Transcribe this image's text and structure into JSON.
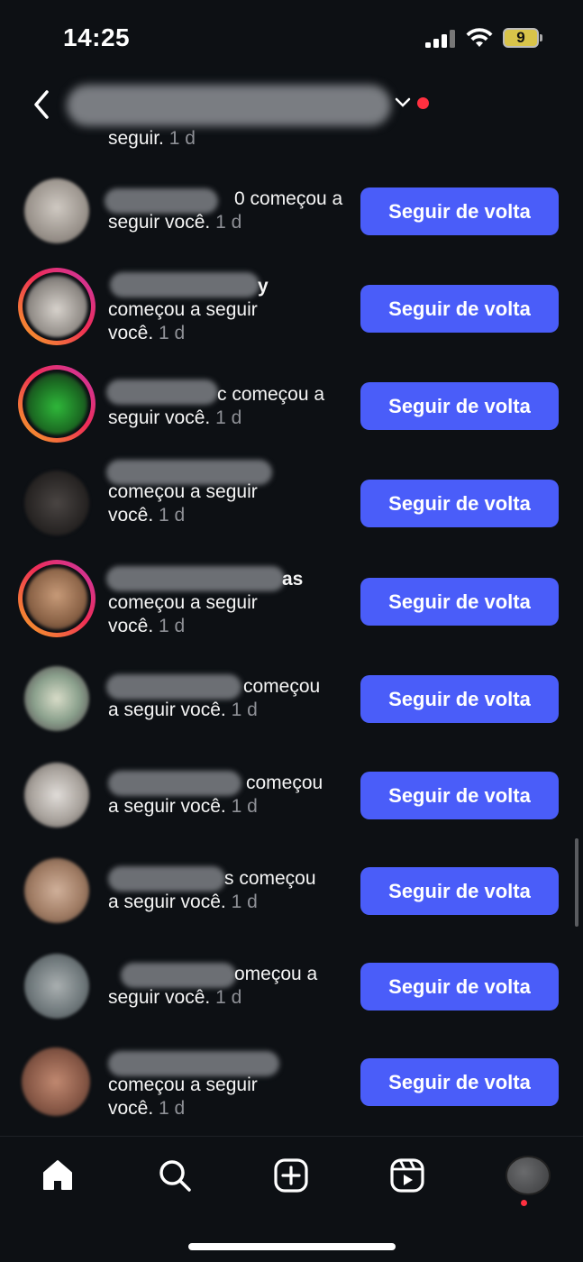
{
  "status_bar": {
    "time": "14:25",
    "battery": "9"
  },
  "header": {
    "title_hidden": true
  },
  "partial_row": {
    "text": "seguir.",
    "time": "1 d"
  },
  "follow_button_label": "Seguir de volta",
  "rows": [
    {
      "suffix": "0 começou a",
      "line2": "seguir você.",
      "time": "1 d"
    },
    {
      "suffix": "y",
      "line2": "começou a seguir",
      "line3": "você.",
      "time": "1 d"
    },
    {
      "suffix": "c começou a",
      "line2": "seguir você.",
      "time": "1 d"
    },
    {
      "suffix": "",
      "line2": "começou a seguir",
      "line3": "você.",
      "time": "1 d"
    },
    {
      "suffix": "as",
      "line2": "começou a seguir",
      "line3": "você.",
      "time": "1 d"
    },
    {
      "suffix": "começou",
      "line2": "a seguir você.",
      "time": "1 d"
    },
    {
      "suffix": "começou",
      "line2": "a seguir você.",
      "time": "1 d"
    },
    {
      "suffix": "s começou",
      "line2": "a seguir você.",
      "time": "1 d"
    },
    {
      "suffix": "omeçou a",
      "line2": "seguir você.",
      "time": "1 d"
    },
    {
      "suffix": "",
      "line2": "começou a seguir",
      "line3": "você.",
      "time": "1 d"
    }
  ],
  "nav": {
    "icons": [
      "home-icon",
      "search-icon",
      "create-icon",
      "reels-icon",
      "profile-avatar"
    ]
  },
  "colors": {
    "accent": "#4a5df9",
    "background": "#0d1014",
    "notification": "#ff3040"
  }
}
